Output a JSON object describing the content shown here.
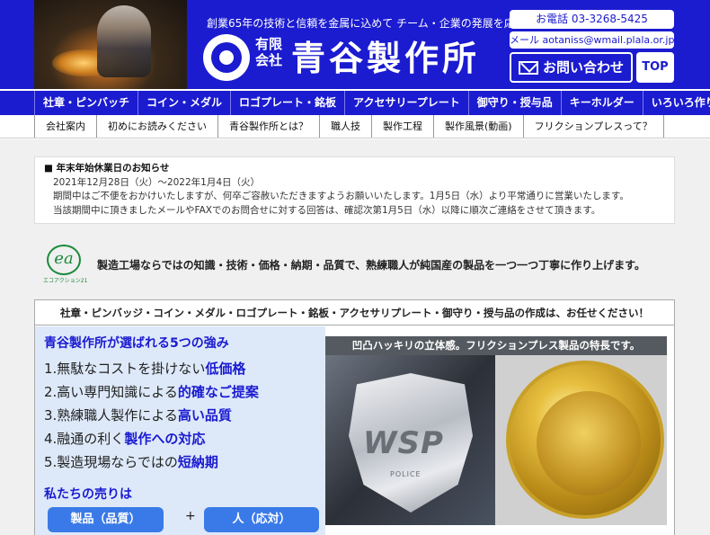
{
  "header": {
    "tagline": "創業65年の技術と信頼を金属に込めて チーム・企業の発展を応援する",
    "company_kind": "有限会社",
    "company_name": "青谷製作所",
    "phone": "お電話 03-3268-5425",
    "email": "メール aotaniss@wmail.plala.or.jp",
    "contact_button": "お問い合わせ",
    "top_button": "TOP"
  },
  "nav_primary": [
    "社章・ピンバッチ",
    "コイン・メダル",
    "ロゴプレート・銘板",
    "アクセサリープレート",
    "御守り・授与品",
    "キーホルダー",
    "いろいろ作ります"
  ],
  "nav_secondary": [
    "会社案内",
    "初めにお読みください",
    "青谷製作所とは？",
    "職人技",
    "製作工程",
    "製作風景(動画)",
    "フリクションプレスって？"
  ],
  "notice": {
    "title": "■ 年末年始休業日のお知らせ",
    "lines": [
      "2021年12月28日（火）～2022年1月4日（火）",
      "期間中はご不便をおかけいたしますが、何卒ご容赦いただきますようお願いいたします。1月5日（水）より平常通りに営業いたします。",
      "当該期間中に頂きましたメールやFAXでのお問合せに対する回答は、確認次第1月5日（水）以降に順次ご連絡をさせて頂きます。"
    ]
  },
  "eco": {
    "logo_letters": "ea",
    "logo_caption": "エコアクション21",
    "text": "製造工場ならではの知識・技術・価格・納期・品質で、熟練職人が純国産の製品を一つ一つ丁寧に作り上げます。"
  },
  "main": {
    "headline": "社章・ピンバッジ・コイン・メダル・ロゴプレート・銘板・アクセサリプレート・御守り・授与品の作成は、お任せください！",
    "strengths_title": "青谷製作所が選ばれる5つの強み",
    "strengths": [
      {
        "prefix": "1.無駄なコストを掛けない",
        "highlight": "低価格"
      },
      {
        "prefix": "2.高い専門知識による",
        "highlight": "的確なご提案"
      },
      {
        "prefix": "3.熟練職人製作による",
        "highlight": "高い品質"
      },
      {
        "prefix": "4.融通の利く",
        "highlight": "製作への対応"
      },
      {
        "prefix": "5.製造現場ならではの",
        "highlight": "短納期"
      }
    ],
    "sell_title": "私たちの売りは",
    "pill_left": "製品（品質）",
    "plus": "+",
    "pill_right": "人（応対）",
    "photo_caption": "凹凸ハッキリの立体感。フリクションプレス製品の特長です。",
    "badge_text": "WSP",
    "badge_sub": "POLICE"
  }
}
